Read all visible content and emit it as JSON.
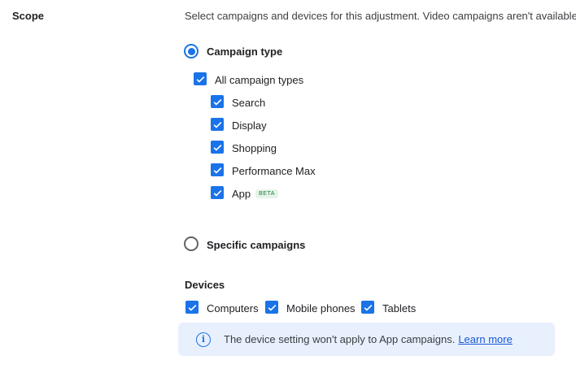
{
  "scope": {
    "label": "Scope",
    "description": "Select campaigns and devices for this adjustment. Video campaigns aren't available."
  },
  "campaign_type": {
    "label": "Campaign type",
    "selected": true,
    "all_label": "All campaign types",
    "items": [
      {
        "label": "Search",
        "checked": true
      },
      {
        "label": "Display",
        "checked": true
      },
      {
        "label": "Shopping",
        "checked": true
      },
      {
        "label": "Performance Max",
        "checked": true
      },
      {
        "label": "App",
        "checked": true,
        "badge": "BETA"
      }
    ]
  },
  "specific_campaigns": {
    "label": "Specific campaigns",
    "selected": false
  },
  "devices": {
    "title": "Devices",
    "items": [
      {
        "label": "Computers",
        "checked": true
      },
      {
        "label": "Mobile phones",
        "checked": true
      },
      {
        "label": "Tablets",
        "checked": true
      }
    ]
  },
  "info": {
    "text": "The device setting won't apply to App campaigns.",
    "link": "Learn more"
  },
  "colors": {
    "accent": "#1a73e8",
    "info_bg": "#e8f0fe",
    "beta_text": "#188038",
    "beta_bg": "#e6f4ea"
  },
  "icons": {
    "help": "help-circle-icon",
    "info": "info-circle-icon",
    "check": "checkmark-icon"
  }
}
